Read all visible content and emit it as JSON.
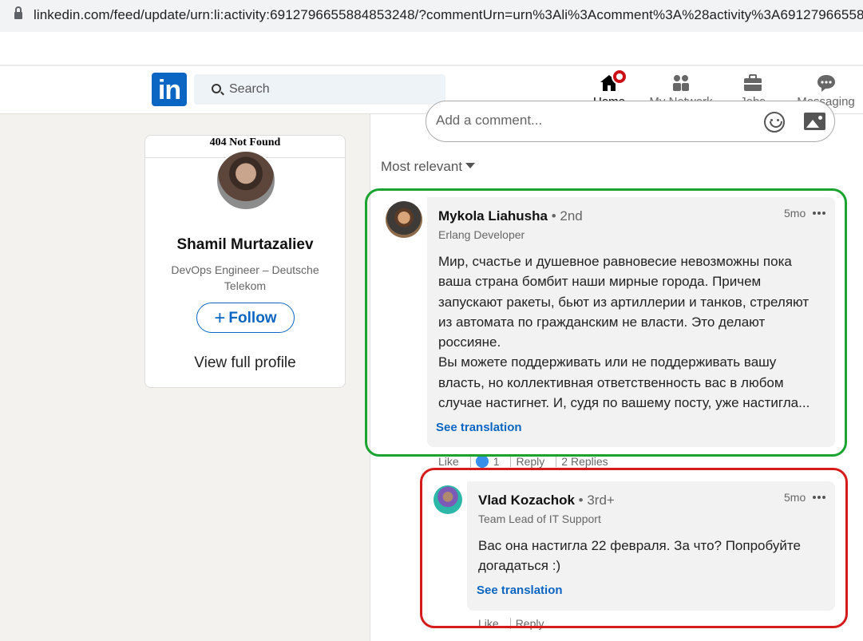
{
  "browser": {
    "url": "linkedin.com/feed/update/urn:li:activity:6912796655884853248/?commentUrn=urn%3Ali%3Acomment%3A%28activity%3A691279665588"
  },
  "nav": {
    "logo": "in",
    "search_placeholder": "Search",
    "items": [
      {
        "label": "Home",
        "icon": "home-icon"
      },
      {
        "label": "My Network",
        "icon": "network-icon"
      },
      {
        "label": "Jobs",
        "icon": "briefcase-icon"
      },
      {
        "label": "Messaging",
        "icon": "chat-icon"
      }
    ]
  },
  "profile": {
    "broken_image_text": "404 Not Found",
    "name": "Shamil Murtazaliev",
    "headline": "DevOps Engineer – Deutsche Telekom",
    "follow_label": "Follow",
    "view_full_profile": "View full profile"
  },
  "comments_section": {
    "add_comment_placeholder": "Add a comment...",
    "sort_label": "Most relevant"
  },
  "comments": [
    {
      "name": "Mykola Liahusha",
      "degree": "• 2nd",
      "headline": "Erlang Developer",
      "time": "5mo",
      "text_lines": [
        "Мир, счастье и душевное равновесие невозможны пока",
        "ваша страна бомбит наши мирные города. Причем",
        "запускают ракеты, бьют из артиллерии и танков, стреляют",
        "из автомата по гражданским не власти. Это делают",
        "россияне.",
        "Вы можете поддерживать или не поддерживать вашу",
        "власть, но коллективная ответственность вас в любом",
        "случае настигнет. И, судя по вашему посту, уже настигла..."
      ],
      "see_translation": "See translation",
      "actions": {
        "like": "Like",
        "like_count": "1",
        "reply": "Reply",
        "replies": "2 Replies"
      }
    },
    {
      "name": "Vlad Kozachok",
      "degree": "• 3rd+",
      "headline": "Team Lead of IT Support",
      "time": "5mo",
      "text_lines": [
        "Вас она настигла 22 февраля. За что? Попробуйте",
        "догадаться :)"
      ],
      "see_translation": "See translation",
      "actions": {
        "like": "Like",
        "reply": "Reply"
      }
    }
  ],
  "colors": {
    "brand": "#0a66c2",
    "highlight_green": "#1aa32f",
    "highlight_red": "#d51b1b",
    "notification": "#cc1016"
  }
}
